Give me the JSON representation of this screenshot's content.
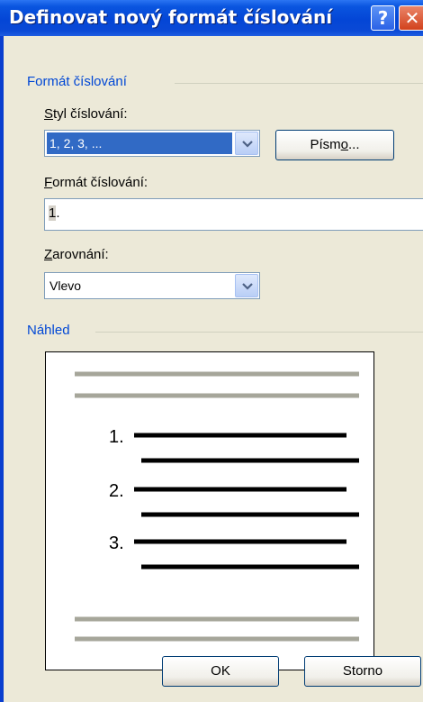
{
  "window": {
    "title": "Definovat nový formát číslování",
    "help_icon": "help-icon",
    "close_icon": "close-icon"
  },
  "format_group": {
    "header": "Formát číslování",
    "style_label_accel": "S",
    "style_label_rest": "tyl číslování:",
    "style_value": "1, 2, 3, ...",
    "font_button_pre": "Písm",
    "font_button_accel": "o",
    "font_button_post": "...",
    "format_label_accel": "F",
    "format_label_rest": "ormát číslování:",
    "format_value_num": "1",
    "format_value_rest": ".",
    "align_label_accel": "Z",
    "align_label_rest": "arovnání:",
    "align_value": "Vlevo"
  },
  "preview_group": {
    "header": "Náhled",
    "items": [
      "1.",
      "2.",
      "3."
    ]
  },
  "buttons": {
    "ok": "OK",
    "cancel": "Storno"
  },
  "colors": {
    "titlebar": "#0a55df",
    "dialog_bg": "#ece9d8",
    "group_header": "#0047d5",
    "selection": "#316ac5",
    "preview_gray_line": "#a6a69a"
  }
}
